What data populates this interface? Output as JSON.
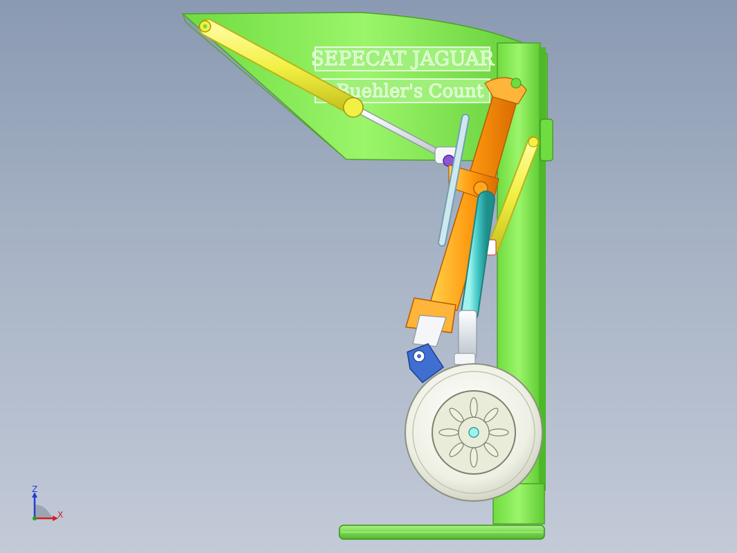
{
  "viewport": {
    "name_plate_line1": "SEPECAT JAGUAR",
    "name_plate_line2": "Buehler's Count",
    "axis_triad": {
      "z_label": "Z",
      "x_label": "X"
    }
  },
  "colors": {
    "background_top": "#8a9ab2",
    "background_bottom": "#c3cad8",
    "frame_green": "#8af05a",
    "strut_orange": "#ff9a10",
    "actuator_yellow": "#f2f044",
    "oleo_teal": "#3fc7c4",
    "tire_white": "#eef0e4",
    "bracket_blue": "#3f6fd0",
    "pin_purple": "#8a55d8"
  },
  "icons": [
    "axis-triad-icon"
  ]
}
